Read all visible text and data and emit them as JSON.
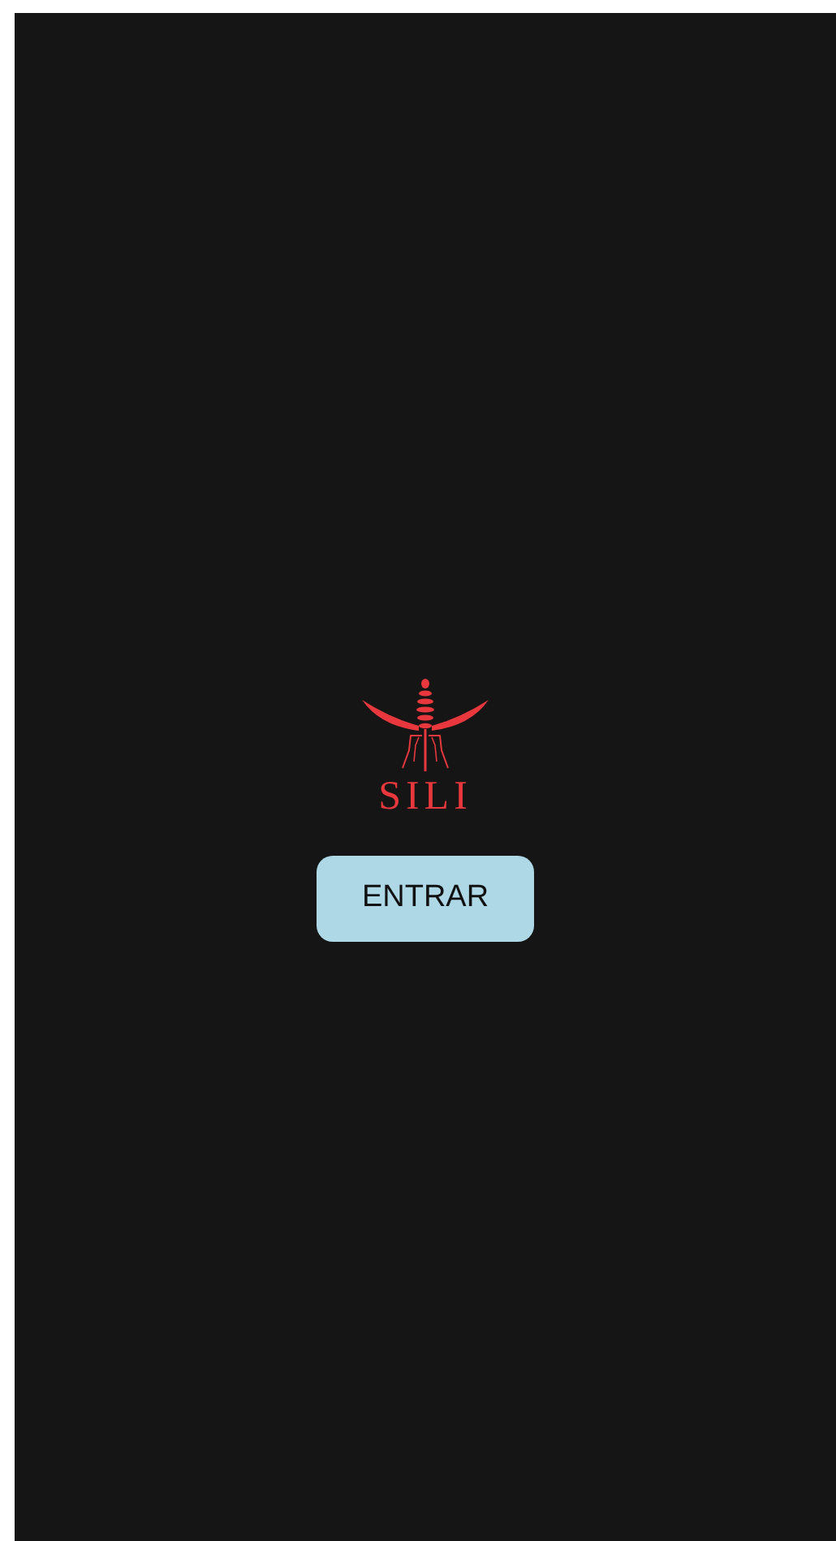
{
  "logo": {
    "text": "SILI"
  },
  "button": {
    "label": "ENTRAR"
  }
}
